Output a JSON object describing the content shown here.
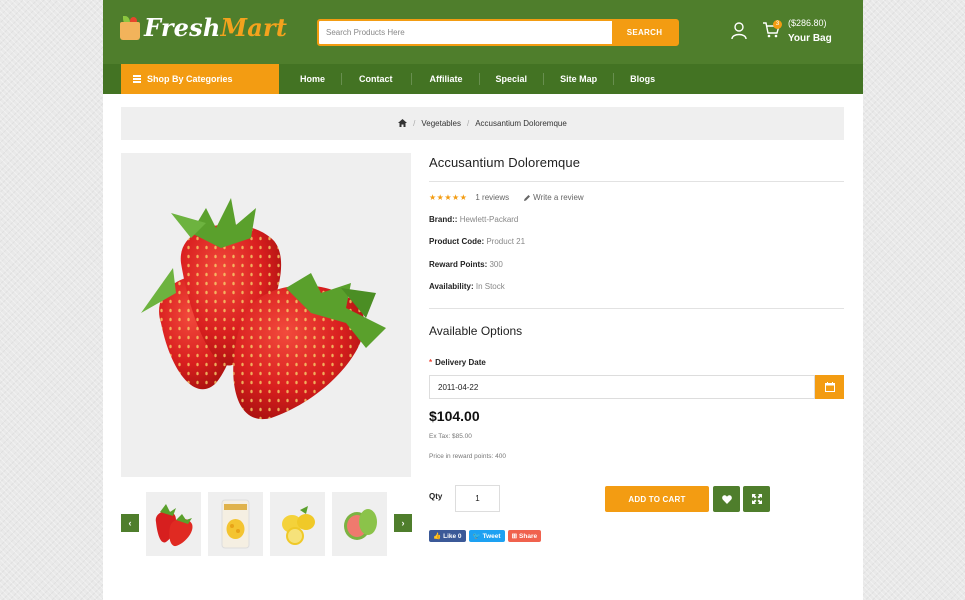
{
  "brand": {
    "name_part1": "Fresh",
    "name_part2": "Mart"
  },
  "search": {
    "placeholder": "Search Products Here",
    "button": "SEARCH"
  },
  "cart": {
    "count": "3",
    "amount": "($286.80)",
    "label": "Your Bag"
  },
  "nav": {
    "categories_label": "Shop By Categories",
    "items": [
      "Home",
      "Contact",
      "Affiliate",
      "Special",
      "Site Map",
      "Blogs"
    ]
  },
  "breadcrumb": {
    "items": [
      "Vegetables",
      "Accusantium Doloremque"
    ]
  },
  "product": {
    "title": "Accusantium Doloremque",
    "rating": 5,
    "reviews": "1 reviews",
    "write_review": "Write a review",
    "brand_label": "Brand::",
    "brand_value": "Hewlett-Packard",
    "code_label": "Product Code:",
    "code_value": "Product 21",
    "reward_label": "Reward Points:",
    "reward_value": "300",
    "availability_label": "Availability:",
    "availability_value": "In Stock",
    "price": "$104.00",
    "ex_tax": "Ex Tax: $85.00",
    "price_points": "Price in reward points: 400"
  },
  "options": {
    "title": "Available Options",
    "delivery_label": "Delivery Date",
    "delivery_value": "2011-04-22"
  },
  "purchase": {
    "qty_label": "Qty",
    "qty_value": "1",
    "add_to_cart": "ADD TO CART"
  },
  "share": {
    "like": "Like 0",
    "tweet": "Tweet",
    "share": "Share"
  },
  "thumbnails": [
    "strawberries",
    "packaged-mango",
    "lemons",
    "guava"
  ],
  "colors": {
    "green": "#4f7e2c",
    "dark_green": "#437323",
    "orange": "#f39c12"
  }
}
